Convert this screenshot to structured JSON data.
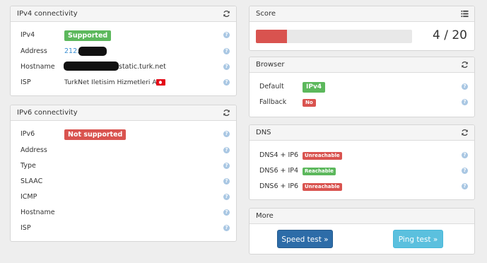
{
  "ipv4": {
    "title": "IPv4 connectivity",
    "rows": [
      {
        "label": "IPv4",
        "value": "Supported"
      },
      {
        "label": "Address",
        "value": "212."
      },
      {
        "label": "Hostname",
        "value": "static.turk.net"
      },
      {
        "label": "ISP",
        "value": "TurkNet Iletisim Hizmetleri A.S."
      }
    ]
  },
  "ipv6": {
    "title": "IPv6 connectivity",
    "rows": [
      {
        "label": "IPv6",
        "value": "Not supported"
      },
      {
        "label": "Address",
        "value": ""
      },
      {
        "label": "Type",
        "value": ""
      },
      {
        "label": "SLAAC",
        "value": ""
      },
      {
        "label": "ICMP",
        "value": ""
      },
      {
        "label": "Hostname",
        "value": ""
      },
      {
        "label": "ISP",
        "value": ""
      }
    ]
  },
  "score": {
    "title": "Score",
    "value": 4,
    "max": 20,
    "text": "4 / 20",
    "bar_color": "#d9534f"
  },
  "browser": {
    "title": "Browser",
    "rows": [
      {
        "label": "Default",
        "value": "IPv4"
      },
      {
        "label": "Fallback",
        "value": "No"
      }
    ]
  },
  "dns": {
    "title": "DNS",
    "rows": [
      {
        "label": "DNS4 + IP6",
        "value": "Unreachable"
      },
      {
        "label": "DNS6 + IP4",
        "value": "Reachable"
      },
      {
        "label": "DNS6 + IP6",
        "value": "Unreachable"
      }
    ]
  },
  "more": {
    "title": "More",
    "speed_label": "Speed test »",
    "ping_label": "Ping test »"
  },
  "help_glyph": "?",
  "colors": {
    "success": "#5cb85c",
    "danger": "#d9534f",
    "primary": "#2d6ca8",
    "info": "#5bc0de"
  },
  "icons": {
    "refresh": "refresh-icon",
    "list": "list-icon",
    "help": "help-icon",
    "flag": "turkey-flag-icon"
  }
}
